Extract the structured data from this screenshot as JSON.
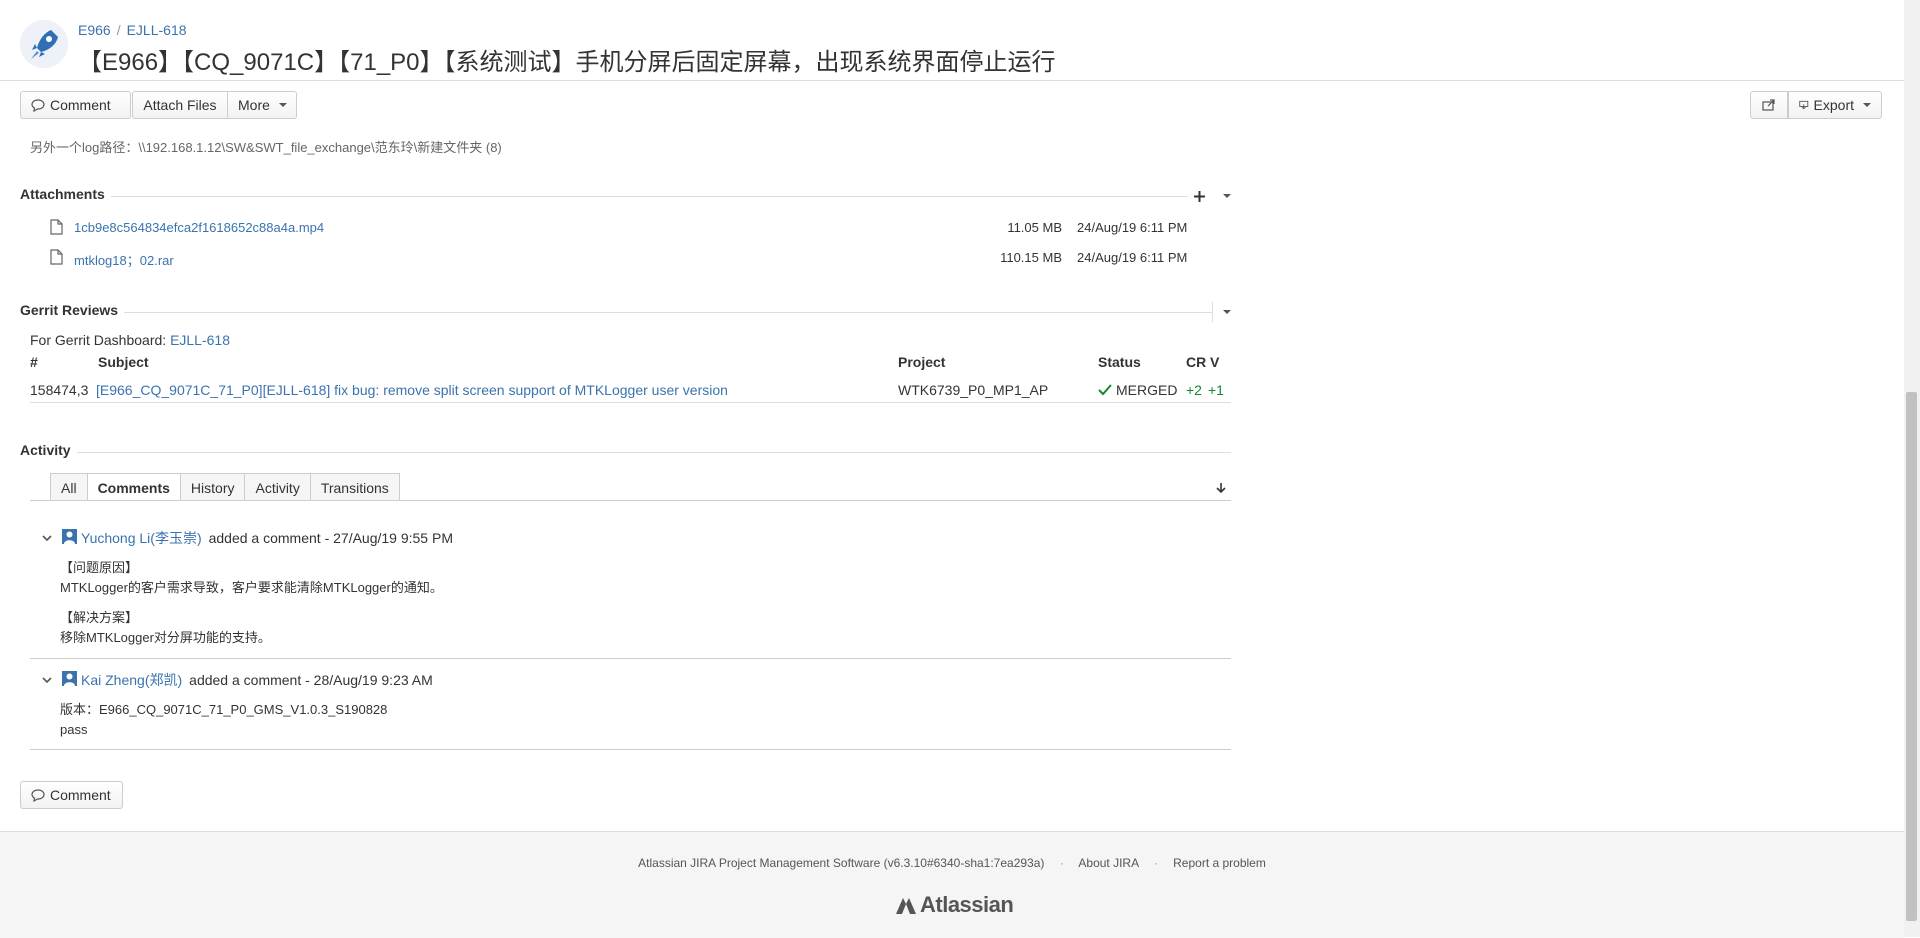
{
  "header": {
    "breadcrumb": [
      "E966",
      "EJLL-618"
    ],
    "breadcrumb_sep": "/",
    "title": "【E966】【CQ_9071C】【71_P0】【系统测试】手机分屏后固定屏幕，出现系统界面停止运行"
  },
  "toolbar": {
    "comment": "Comment",
    "attach_files": "Attach Files",
    "more": "More",
    "export": "Export"
  },
  "description": {
    "log_path": "另外一个log路径：\\\\192.168.1.12\\SW&SWT_file_exchange\\范东玲\\新建文件夹 (8)"
  },
  "attachments": {
    "title": "Attachments",
    "files": [
      {
        "name": "1cb9e8c564834efca2f1618652c88a4a.mp4",
        "size": "11.05 MB",
        "date": "24/Aug/19 6:11 PM"
      },
      {
        "name": "mtklog18；02.rar",
        "size": "110.15 MB",
        "date": "24/Aug/19 6:11 PM"
      }
    ]
  },
  "gerrit": {
    "title": "Gerrit Reviews",
    "dashboard_label": "For Gerrit Dashboard:",
    "dashboard_link": "EJLL-618",
    "columns": [
      "#",
      "Subject",
      "Project",
      "Status",
      "CR",
      "V"
    ],
    "rows": [
      {
        "num": "158474,3",
        "subject": "[E966_CQ_9071C_71_P0][EJLL-618] fix bug: remove split screen support of MTKLogger user version",
        "project": "WTK6739_P0_MP1_AP",
        "status": "MERGED",
        "cr": "+2",
        "v": "+1"
      }
    ]
  },
  "activity": {
    "title": "Activity",
    "tabs": [
      "All",
      "Comments",
      "History",
      "Activity",
      "Transitions"
    ],
    "active_tab": "Comments",
    "comments": [
      {
        "author": "Yuchong Li(李玉崇)",
        "meta": "added a comment - 27/Aug/19 9:55 PM",
        "lines": [
          "【问题原因】",
          "MTKLogger的客户需求导致，客户要求能清除MTKLogger的通知。",
          "【解决方案】",
          "移除MTKLogger对分屏功能的支持。"
        ]
      },
      {
        "author": "Kai Zheng(郑凯)",
        "meta": "added a comment - 28/Aug/19 9:23 AM",
        "lines": [
          "版本：E966_CQ_9071C_71_P0_GMS_V1.0.3_S190828",
          "pass"
        ]
      }
    ],
    "bottom_comment": "Comment"
  },
  "footer": {
    "software": "Atlassian JIRA Project Management Software (v6.3.10#6340-sha1:7ea293a)",
    "about": "About JIRA",
    "report": "Report a problem",
    "dot": "·",
    "logo": "Atlassian"
  },
  "colors": {
    "link": "#3b73af",
    "merged_check": "#14892c",
    "vote_plus": "#14892c"
  }
}
